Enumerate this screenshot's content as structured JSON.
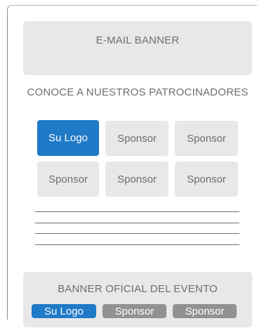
{
  "email_banner": {
    "label": "E-MAIL BANNER"
  },
  "sponsors_section": {
    "title": "CONOCE A NUESTROS PATROCINADORES",
    "tiles": [
      {
        "label": "Su Logo",
        "highlighted": true
      },
      {
        "label": "Sponsor",
        "highlighted": false
      },
      {
        "label": "Sponsor",
        "highlighted": false
      },
      {
        "label": "Sponsor",
        "highlighted": false
      },
      {
        "label": "Sponsor",
        "highlighted": false
      },
      {
        "label": "Sponsor",
        "highlighted": false
      }
    ]
  },
  "event_banner": {
    "title": "BANNER OFICIAL DEL EVENTO",
    "pills": [
      {
        "label": "Su Logo",
        "highlighted": true
      },
      {
        "label": "Sponsor",
        "highlighted": false
      },
      {
        "label": "Sponsor",
        "highlighted": false
      }
    ]
  },
  "colors": {
    "accent": "#1f7ac7",
    "placeholder": "#e8e8e8",
    "pill_gray": "#919191",
    "text_gray": "#6e6e6e"
  }
}
